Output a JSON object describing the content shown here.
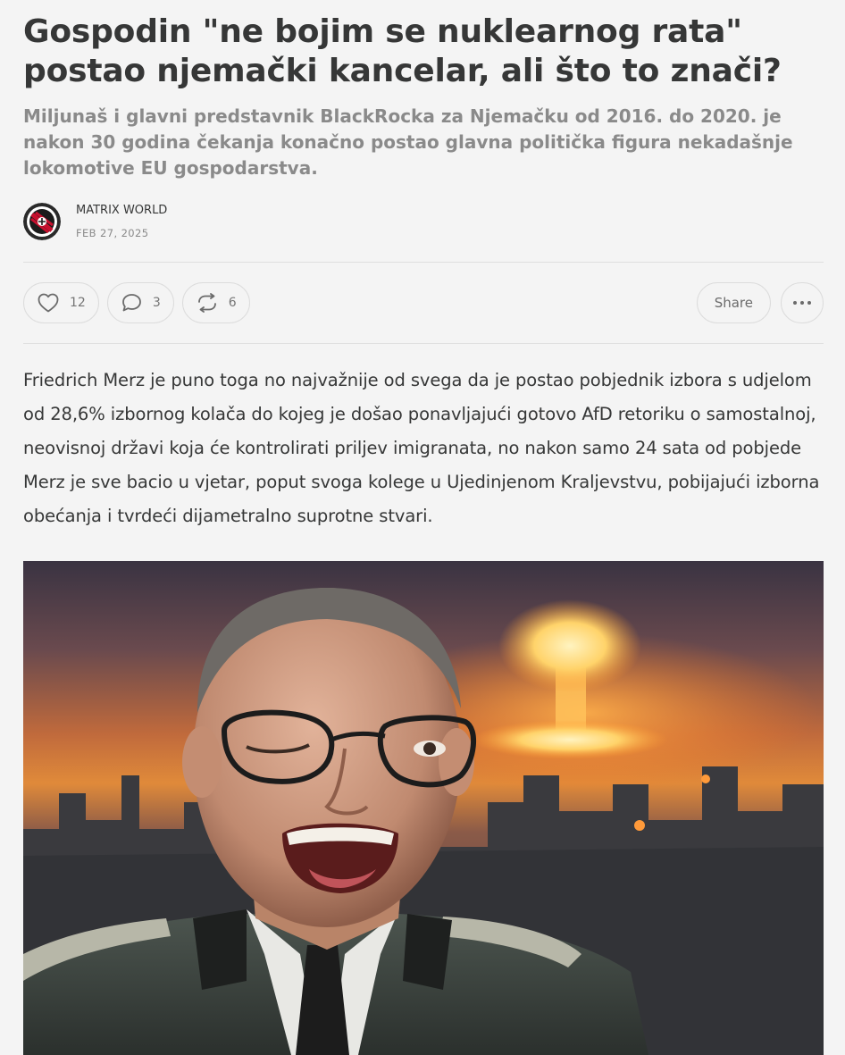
{
  "article": {
    "title": "Gospodin \"ne bojim se nuklearnog rata\" postao njemački kancelar, ali što to znači?",
    "subtitle": "Miljunaš i glavni predstavnik BlackRocka za Njemačku od 2016. do 2020. je nakon 30 godina čekanja konačno postao glavna politička figura nekadašnje lokomotive EU gospodarstva.",
    "body_paragraph": "Friedrich Merz je puno toga no najvažnije od svega da je postao pobjednik izbora s udjelom od 28,6% izbornog kolača do kojeg je došao ponavljajući gotovo AfD retoriku o samostalnoj, neovisnoj državi koja će kontrolirati priljev imigranata, no nakon samo 24 sata od pobjede Merz je sve bacio u vjetar, poput svoga kolege u Ujedinjenom Kraljevstvu, pobijajući izborna obećanja i tvrdeći dijametralno suprotne stvari."
  },
  "byline": {
    "author": "MATRIX WORLD",
    "date": "FEB 27, 2025",
    "avatar_icon": "matrix-world-logo"
  },
  "actions": {
    "like": {
      "icon": "heart-icon",
      "count": "12"
    },
    "comment": {
      "icon": "speech-bubble-icon",
      "count": "3"
    },
    "restack": {
      "icon": "restack-arrows-icon",
      "count": "6"
    },
    "share_label": "Share",
    "more_icon": "ellipsis-icon"
  },
  "colors": {
    "background": "#f4f4f4",
    "text": "#363737",
    "muted": "#8a8a8a",
    "border": "#dcdcdc"
  }
}
